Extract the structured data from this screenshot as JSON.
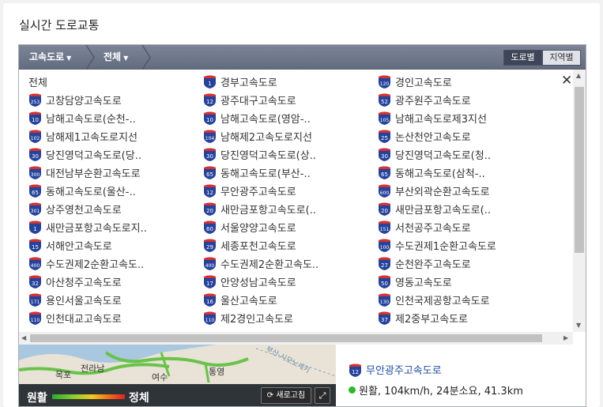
{
  "page": {
    "title": "실시간 도로교통"
  },
  "breadcrumb": {
    "level1": "고속도로",
    "level2": "전체"
  },
  "view_toggle": {
    "by_road": "도로별",
    "by_region": "지역별",
    "selected": "도로별"
  },
  "list": {
    "close_symbol": "✕",
    "rows": [
      [
        {
          "num": "",
          "label": "전체"
        },
        {
          "num": "1",
          "label": "경부고속도로"
        },
        {
          "num": "120",
          "label": "경인고속도로"
        }
      ],
      [
        {
          "num": "253",
          "label": "고창담양고속도로"
        },
        {
          "num": "12",
          "label": "광주대구고속도로"
        },
        {
          "num": "52",
          "label": "광주원주고속도로"
        }
      ],
      [
        {
          "num": "10",
          "label": "남해고속도로(순천-.."
        },
        {
          "num": "10",
          "label": "남해고속도로(영암-.."
        },
        {
          "num": "105",
          "label": "남해고속도로제3지선"
        }
      ],
      [
        {
          "num": "102",
          "label": "남해제1고속도로지선"
        },
        {
          "num": "104",
          "label": "남해제2고속도로지선"
        },
        {
          "num": "25",
          "label": "논산천안고속도로"
        }
      ],
      [
        {
          "num": "30",
          "label": "당진영덕고속도로(당.."
        },
        {
          "num": "30",
          "label": "당진영덕고속도로(상.."
        },
        {
          "num": "30",
          "label": "당진영덕고속도로(청.."
        }
      ],
      [
        {
          "num": "300",
          "label": "대전남부순환고속도로"
        },
        {
          "num": "65",
          "label": "동해고속도로(부산-.."
        },
        {
          "num": "65",
          "label": "동해고속도로(삼척-.."
        }
      ],
      [
        {
          "num": "65",
          "label": "동해고속도로(울산-.."
        },
        {
          "num": "12",
          "label": "무안광주고속도로"
        },
        {
          "num": "600",
          "label": "부산외곽순환고속도로"
        }
      ],
      [
        {
          "num": "301",
          "label": "상주영천고속도로"
        },
        {
          "num": "20",
          "label": "새만금포항고속도로(.."
        },
        {
          "num": "20",
          "label": "새만금포항고속도로(.."
        }
      ],
      [
        {
          "num": "1",
          "label": "새만금포항고속도로지.."
        },
        {
          "num": "60",
          "label": "서울양양고속도로"
        },
        {
          "num": "151",
          "label": "서천공주고속도로"
        }
      ],
      [
        {
          "num": "15",
          "label": "서해안고속도로"
        },
        {
          "num": "29",
          "label": "세종포천고속도로"
        },
        {
          "num": "100",
          "label": "수도권제1순환고속도로"
        }
      ],
      [
        {
          "num": "400",
          "label": "수도권제2순환고속도.."
        },
        {
          "num": "400",
          "label": "수도권제2순환고속도.."
        },
        {
          "num": "27",
          "label": "순천완주고속도로"
        }
      ],
      [
        {
          "num": "32",
          "label": "아산청주고속도로"
        },
        {
          "num": "17",
          "label": "안양성남고속도로"
        },
        {
          "num": "50",
          "label": "영동고속도로"
        }
      ],
      [
        {
          "num": "171",
          "label": "용인서울고속도로"
        },
        {
          "num": "16",
          "label": "울산고속도로"
        },
        {
          "num": "130",
          "label": "인천국제공항고속도로"
        }
      ],
      [
        {
          "num": "110",
          "label": "인천대교고속도로"
        },
        {
          "num": "110",
          "label": "제2경인고속도로"
        },
        {
          "num": "37",
          "label": "제2중부고속도로"
        }
      ]
    ]
  },
  "map": {
    "places": [
      "목포",
      "전라남",
      "여수",
      "통영",
      "부산-시모노세키"
    ],
    "legend_good": "원활",
    "legend_bad": "정체",
    "refresh_label": "새로고침",
    "expand_icon": "⤢"
  },
  "info": {
    "road_num": "12",
    "road_name": "무안광주고속도로",
    "status_text": "원활, 104km/h, 24분소요, 41.3km",
    "status_color": "#2eb82e"
  }
}
